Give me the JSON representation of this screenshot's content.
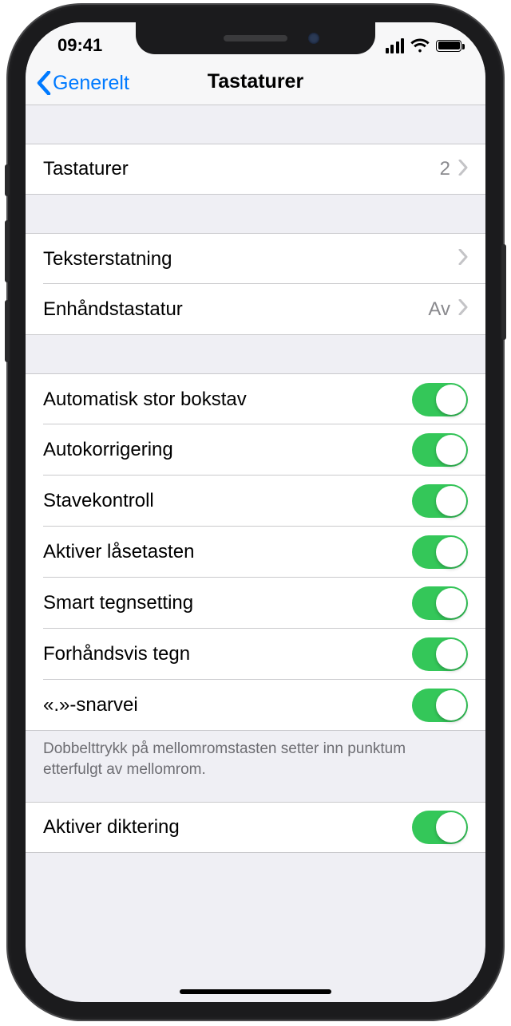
{
  "status": {
    "time": "09:41"
  },
  "nav": {
    "back": "Generelt",
    "title": "Tastaturer"
  },
  "rows": {
    "keyboards": {
      "label": "Tastaturer",
      "count": "2"
    },
    "textrepl": {
      "label": "Teksterstatning"
    },
    "onehand": {
      "label": "Enhåndstastatur",
      "value": "Av"
    },
    "autocap": {
      "label": "Automatisk stor bokstav"
    },
    "autocorr": {
      "label": "Autokorrigering"
    },
    "spell": {
      "label": "Stavekontroll"
    },
    "capslock": {
      "label": "Aktiver låsetasten"
    },
    "smartpunct": {
      "label": "Smart tegnsetting"
    },
    "preview": {
      "label": "Forhåndsvis tegn"
    },
    "shortcut": {
      "label": "«.»-snarvei"
    },
    "dictation": {
      "label": "Aktiver diktering"
    }
  },
  "footer": "Dobbelttrykk på mellomromstasten setter inn punktum etterfulgt av mellomrom."
}
